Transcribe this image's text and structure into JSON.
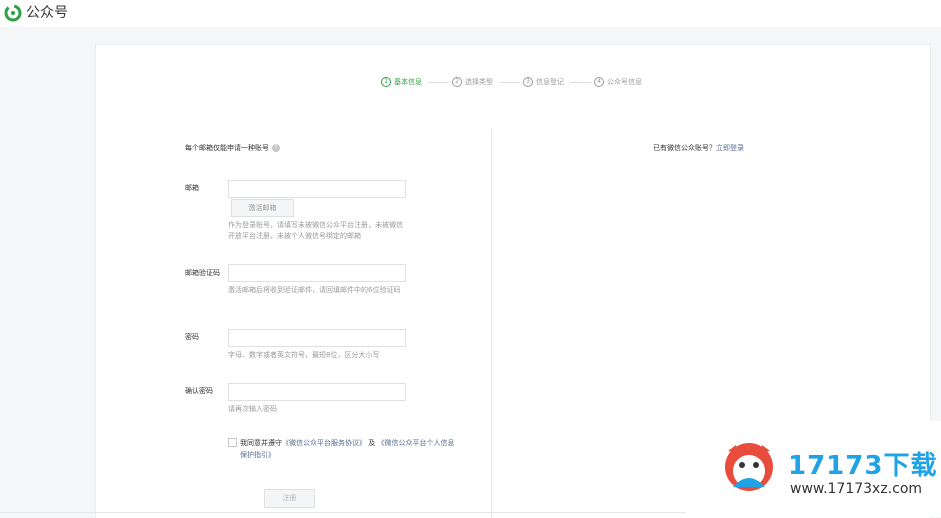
{
  "app": {
    "title": "公众号"
  },
  "steps": [
    {
      "num": "1",
      "label": "基本信息",
      "active": true
    },
    {
      "num": "2",
      "label": "选择类型",
      "active": false
    },
    {
      "num": "3",
      "label": "信息登记",
      "active": false
    },
    {
      "num": "4",
      "label": "公众号信息",
      "active": false
    }
  ],
  "form": {
    "hint": "每个邮箱仅能申请一种账号",
    "email": {
      "label": "邮箱",
      "value": "",
      "activate_button": "激活邮箱",
      "tip": "作为登录账号，请填写未被微信公众平台注册，未被微信开放平台注册，未被个人微信号绑定的邮箱"
    },
    "code": {
      "label": "邮箱验证码",
      "value": "",
      "tip": "激活邮箱后将收到验证邮件，请回填邮件中的6位验证码"
    },
    "password": {
      "label": "密码",
      "value": "",
      "tip": "字母、数字或者英文符号，最短8位，区分大小写"
    },
    "confirm": {
      "label": "确认密码",
      "value": "",
      "tip": "请再次输入密码"
    },
    "agree": {
      "prefix": "我同意并遵守",
      "link1": "《微信公众平台服务协议》",
      "middle": " 及 ",
      "link2": "《微信公众平台个人信息保护指引》"
    },
    "register_button": "注册"
  },
  "login": {
    "text": "已有微信公众账号？",
    "link": "立即登录"
  },
  "watermark": {
    "title": "17173下载",
    "url": "www.17173xz.com"
  },
  "colors": {
    "brand_green": "#2ba245",
    "link_blue": "#576b95",
    "watermark_blue": "#1fa3e6"
  }
}
